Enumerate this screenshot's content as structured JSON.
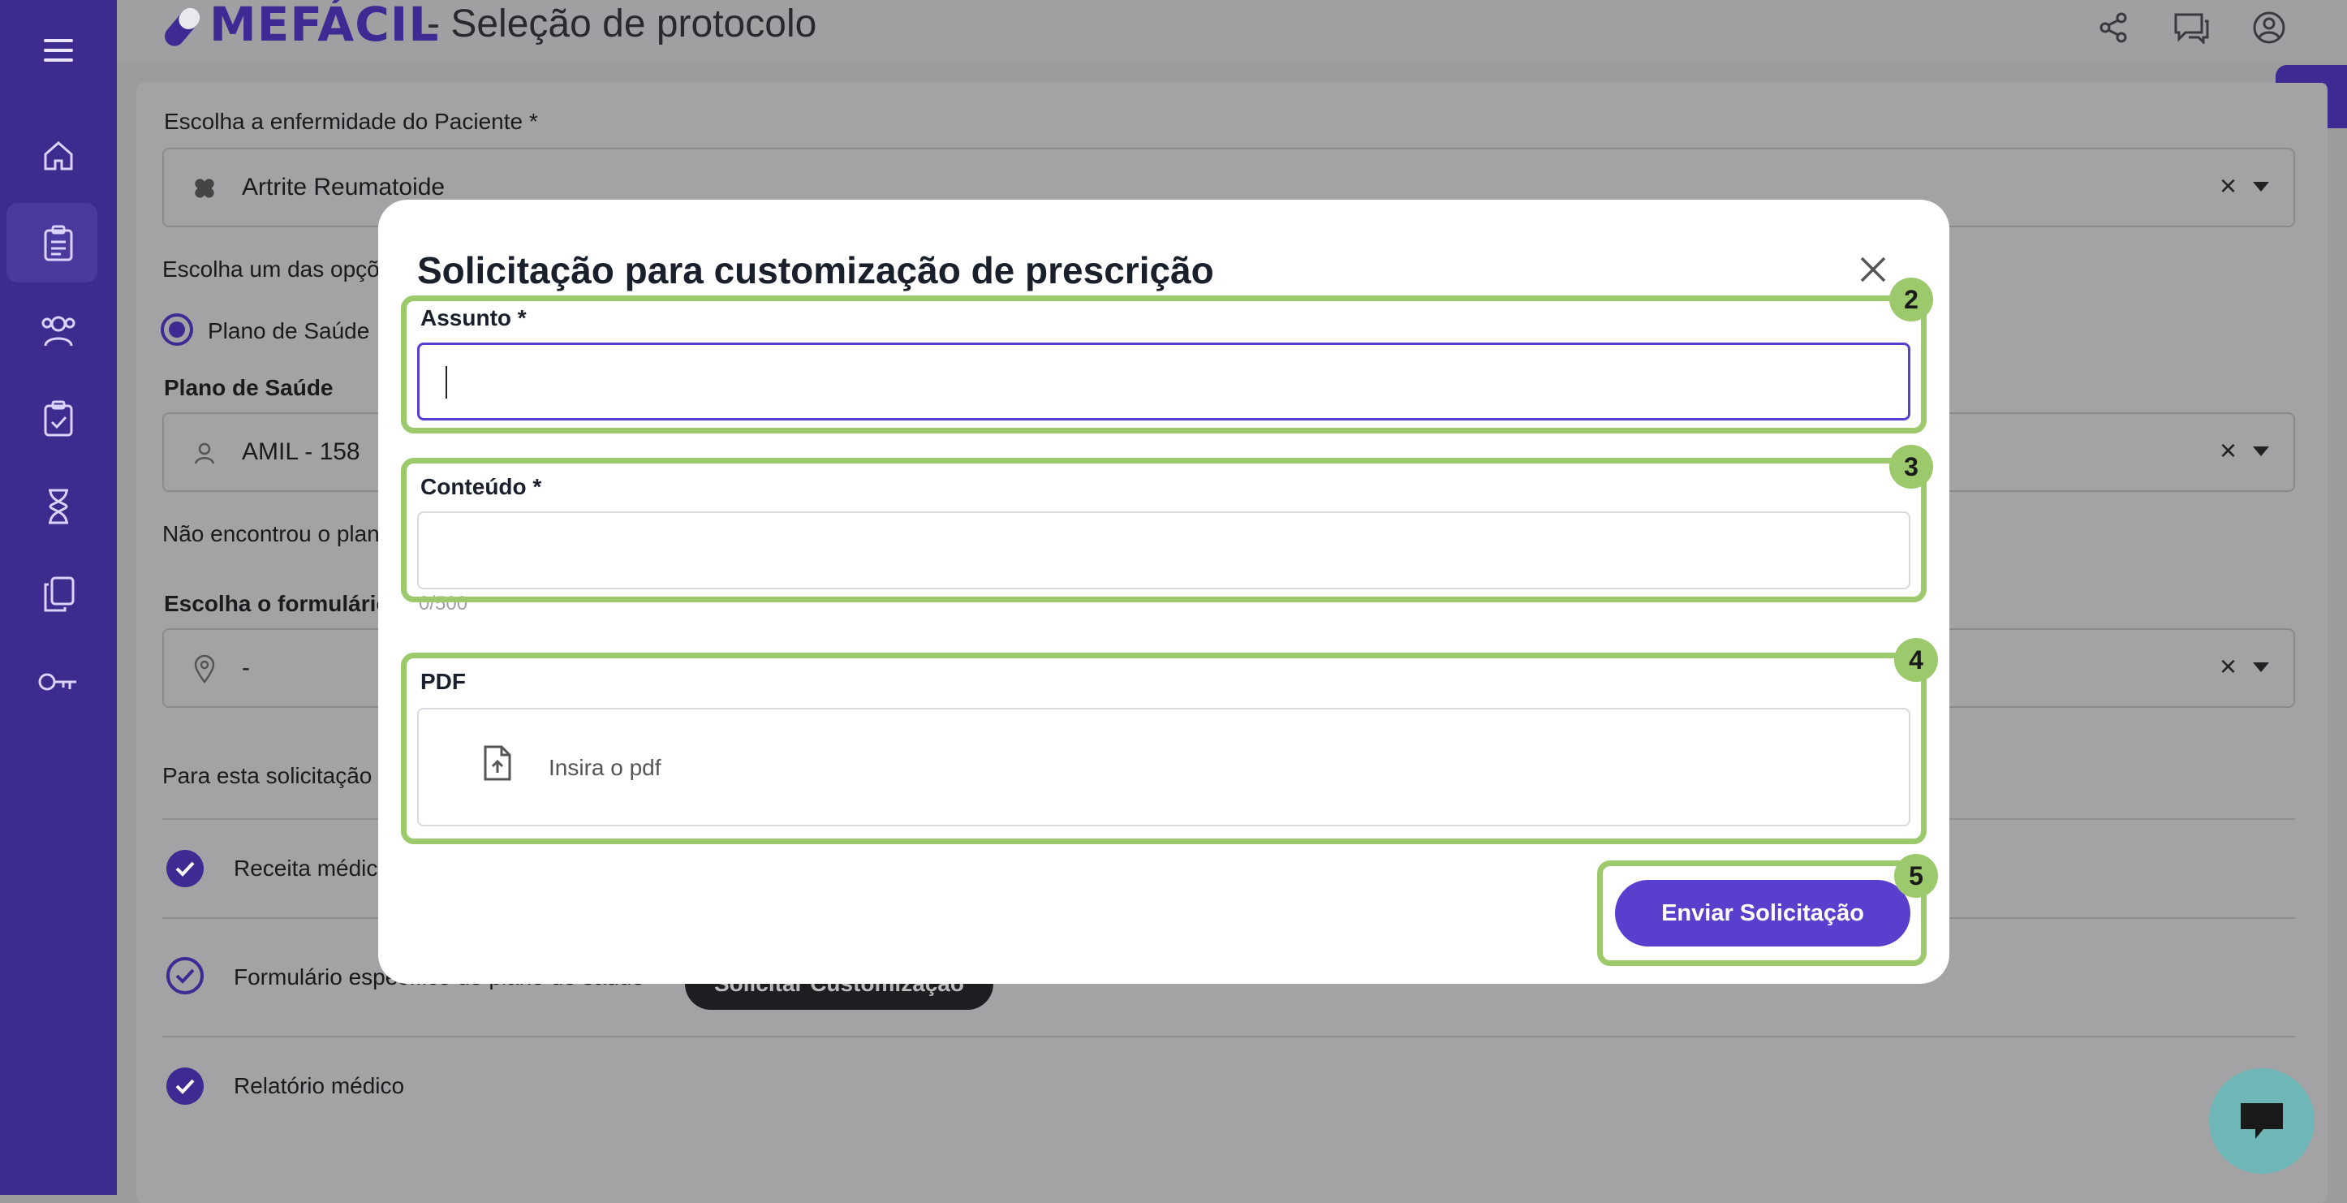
{
  "header": {
    "brand": "MEFÁCIL",
    "title": "- Seleção de protocolo"
  },
  "sidebar": {
    "items": [
      {
        "name": "menu-icon"
      },
      {
        "name": "home-icon"
      },
      {
        "name": "clipboard-list-icon",
        "active": true
      },
      {
        "name": "users-icon"
      },
      {
        "name": "clipboard-check-icon"
      },
      {
        "name": "hourglass-icon"
      },
      {
        "name": "copy-icon"
      },
      {
        "name": "key-icon"
      }
    ]
  },
  "form": {
    "disease_label": "Escolha a enfermidade do Paciente *",
    "disease_value": "Artrite Reumatoide",
    "options_label": "Escolha um das opçõ",
    "radio_label": "Plano de Saúde",
    "plan_label": "Plano de Saúde",
    "plan_value": "AMIL - 158",
    "not_found_text": "Não encontrou o plan",
    "form_label": "Escolha o formulário",
    "form_value": "-",
    "request_text": "Para esta solicitação",
    "checks": [
      {
        "label": "Receita médic"
      },
      {
        "label": "Formulário específico do plano de saúde"
      },
      {
        "label": "Relatório médico"
      }
    ],
    "customize_button": "Solicitar Customização"
  },
  "modal": {
    "title": "Solicitação para customização de prescrição",
    "subject_label": "Assunto *",
    "subject_value": "",
    "content_label": "Conteúdo *",
    "content_value": "",
    "counter": "0/500",
    "pdf_label": "PDF",
    "pdf_placeholder": "Insira o pdf",
    "submit_label": "Enviar Solicitação"
  },
  "annotations": [
    {
      "number": "2"
    },
    {
      "number": "3"
    },
    {
      "number": "4"
    },
    {
      "number": "5"
    }
  ],
  "colors": {
    "brand": "#3f2a94",
    "primary_button": "#5a3fcf",
    "highlight": "#9cc96b"
  }
}
